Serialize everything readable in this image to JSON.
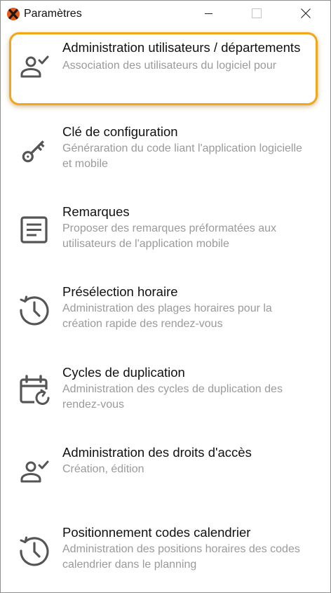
{
  "window": {
    "title": "Paramètres",
    "controls": {
      "minimize": "minimize",
      "maximize": "maximize",
      "close": "close"
    }
  },
  "colors": {
    "highlight_border": "#f2a61c",
    "icon": "#555555",
    "title_text": "#111111",
    "description_text": "#9a9a9a"
  },
  "items": [
    {
      "icon": "user-check-icon",
      "title": "Administration utilisateurs / départements",
      "description": "Association des utilisateurs du logiciel pour",
      "highlighted": true
    },
    {
      "icon": "key-icon",
      "title": "Clé de configuration",
      "description": "Généraration du code liant l'application logicielle et mobile"
    },
    {
      "icon": "notes-icon",
      "title": "Remarques",
      "description": "Proposer des remarques préformatées aux utilisateurs de l'application mobile"
    },
    {
      "icon": "clock-history-icon",
      "title": "Présélection horaire",
      "description": "Administration des plages horaires pour la création rapide des rendez-vous"
    },
    {
      "icon": "calendar-sync-icon",
      "title": "Cycles de duplication",
      "description": "Administration des cycles de duplication des rendez-vous"
    },
    {
      "icon": "user-check-icon",
      "title": "Administration des droits d'accès",
      "description": "Création, édition"
    },
    {
      "icon": "clock-history-icon",
      "title": "Positionnement codes calendrier",
      "description": "Administration des positions horaires des codes calendrier dans le planning"
    }
  ]
}
